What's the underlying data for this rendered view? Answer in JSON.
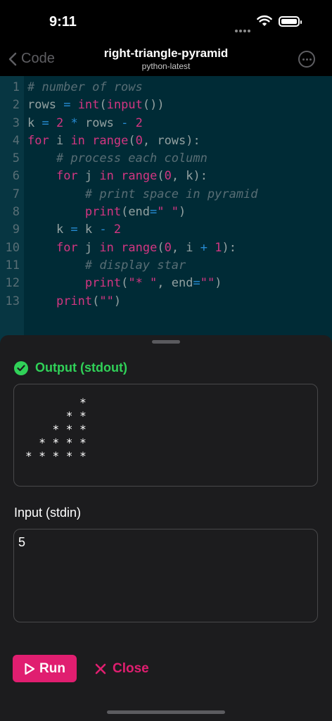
{
  "status": {
    "time": "9:11"
  },
  "nav": {
    "back_label": "Code",
    "title": "right-triangle-pyramid",
    "subtitle": "python-latest"
  },
  "editor": {
    "lines": [
      {
        "n": "1"
      },
      {
        "n": "2"
      },
      {
        "n": "3"
      },
      {
        "n": "4"
      },
      {
        "n": "5"
      },
      {
        "n": "6"
      },
      {
        "n": "7"
      },
      {
        "n": "8"
      },
      {
        "n": "9"
      },
      {
        "n": "10"
      },
      {
        "n": "11"
      },
      {
        "n": "12"
      },
      {
        "n": "13"
      }
    ],
    "code": [
      "# number of rows",
      "rows = int(input())",
      "k = 2 * rows - 2",
      "for i in range(0, rows):",
      "    # process each column",
      "    for j in range(0, k):",
      "        # print space in pyramid",
      "        print(end=\" \")",
      "    k = k - 2",
      "    for j in range(0, i + 1):",
      "        # display star",
      "        print(\"* \", end=\"\")",
      "    print(\"\")"
    ]
  },
  "output": {
    "title": "Output (stdout)",
    "text": "        *\n      * *\n    * * *\n  * * * *\n* * * * *"
  },
  "input": {
    "label": "Input (stdin)",
    "value": "5"
  },
  "actions": {
    "run_label": "Run",
    "close_label": "Close"
  },
  "colors": {
    "accent": "#e01e70",
    "success": "#30d158",
    "editor_bg": "#002b36"
  }
}
